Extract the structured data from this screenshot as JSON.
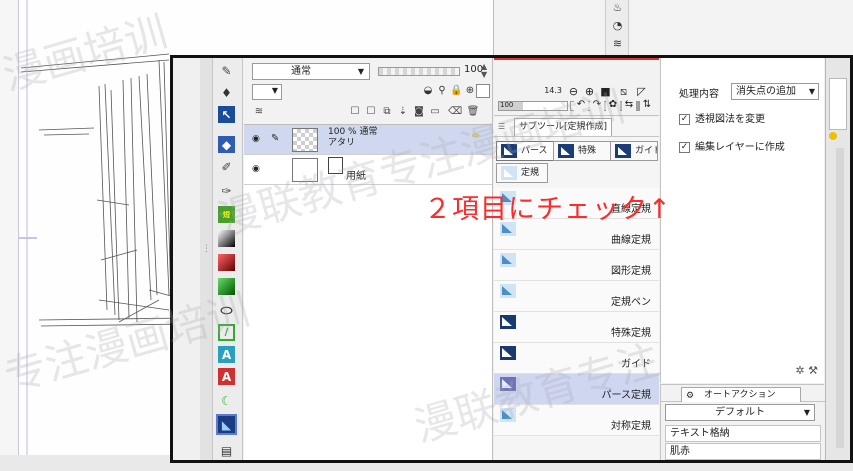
{
  "layer_panel": {
    "blend_mode": "通常",
    "opacity": "100",
    "layers": [
      {
        "line1": "100 %  通常",
        "line2": "アタリ",
        "selected": true
      },
      {
        "name": "用紙",
        "selected": false
      }
    ]
  },
  "navigator": {
    "zoom": "14.3",
    "zoom_slider": "100"
  },
  "subtool": {
    "title": "サブツール[定規作成]",
    "group_tabs": [
      "パース",
      "特殊",
      "ガイド",
      "定規"
    ],
    "items": [
      {
        "label": "直線定規",
        "style": "light"
      },
      {
        "label": "曲線定規",
        "style": "light"
      },
      {
        "label": "図形定規",
        "style": "light"
      },
      {
        "label": "定規ペン",
        "style": "light"
      },
      {
        "label": "特殊定規",
        "style": "dark"
      },
      {
        "label": "ガイド",
        "style": "dark"
      },
      {
        "label": "パース定規",
        "style": "sel",
        "selected": true
      },
      {
        "label": "対称定規",
        "style": "light"
      }
    ]
  },
  "tool_property": {
    "process_label": "処理内容",
    "process_value": "消失点の追加",
    "checks": [
      {
        "label": "透視図法を変更",
        "checked": true
      },
      {
        "label": "編集レイヤーに作成",
        "checked": true
      }
    ]
  },
  "auto_action": {
    "title": "オートアクション",
    "set": "デフォルト",
    "items": [
      "テキスト格納",
      "肌赤"
    ]
  },
  "annotation": {
    "text": "２項目にチェック↑",
    "color": "#ff2a2a"
  },
  "watermark": {
    "phrases": [
      "漫画培训",
      "漫联教育专注漫画培训",
      "专注漫画培训",
      "漫联教育专注"
    ]
  }
}
